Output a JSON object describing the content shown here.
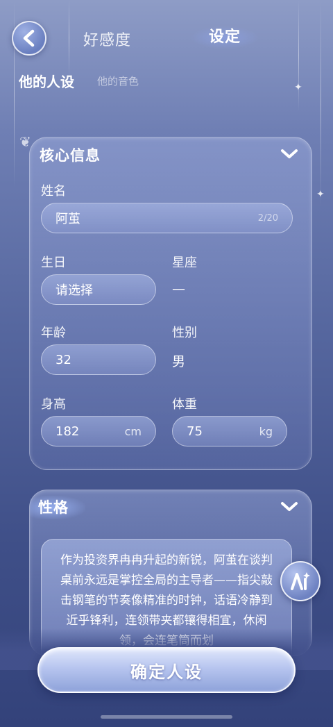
{
  "header": {
    "tabs": [
      {
        "label": "好感度",
        "active": false
      },
      {
        "label": "设定",
        "active": true
      }
    ]
  },
  "subtabs": [
    {
      "label": "他的人设",
      "active": true
    },
    {
      "label": "他的音色",
      "active": false
    }
  ],
  "core_info": {
    "title": "核心信息",
    "name_label": "姓名",
    "name_value": "阿茧",
    "name_counter": "2/20",
    "birthday_label": "生日",
    "birthday_value": "请选择",
    "zodiac_label": "星座",
    "zodiac_value": "—",
    "age_label": "年龄",
    "age_value": "32",
    "gender_label": "性别",
    "gender_value": "男",
    "height_label": "身高",
    "height_value": "182",
    "height_unit": "cm",
    "weight_label": "体重",
    "weight_value": "75",
    "weight_unit": "kg"
  },
  "personality": {
    "title": "性格",
    "text": "作为投资界冉冉升起的新锐，阿茧在谈判桌前永远是掌控全局的主导者——指尖敲击钢笔的节奏像精准的时钟，话语冷静到近乎锋利，连领带夹都镶得相宜，休闲领，会连笔筒而划"
  },
  "ai_button": {
    "label": "Ai"
  },
  "confirm_button": {
    "label": "确定人设"
  },
  "colors": {
    "background_top": "#8e9cc6",
    "background_bottom": "#33427a",
    "accent": "#b7c5ef"
  }
}
